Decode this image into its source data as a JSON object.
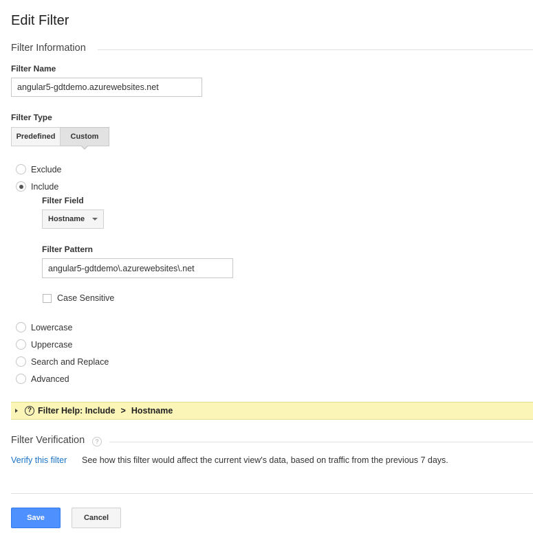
{
  "page": {
    "title": "Edit Filter"
  },
  "info_section": {
    "title": "Filter Information",
    "name_label": "Filter Name",
    "name_value": "angular5-gdtdemo.azurewebsites.net",
    "type_label": "Filter Type",
    "type_tabs": [
      "Predefined",
      "Custom"
    ],
    "selected_type": "Custom"
  },
  "options": {
    "exclude_label": "Exclude",
    "include_label": "Include",
    "selected": "Include",
    "include_panel": {
      "field_label": "Filter Field",
      "field_value": "Hostname",
      "pattern_label": "Filter Pattern",
      "pattern_value": "angular5-gdtdemo\\.azurewebsites\\.net",
      "case_sensitive_label": "Case Sensitive",
      "case_sensitive_checked": false
    },
    "lowercase_label": "Lowercase",
    "uppercase_label": "Uppercase",
    "search_replace_label": "Search and Replace",
    "advanced_label": "Advanced"
  },
  "help_bar": {
    "prefix": "Filter Help: ",
    "option": "Include",
    "separator": ">",
    "field": "Hostname",
    "icon_glyph": "?"
  },
  "verification": {
    "title": "Filter Verification",
    "help_glyph": "?",
    "link_label": "Verify this filter",
    "description": "See how this filter would affect the current view's data, based on traffic from the previous 7 days."
  },
  "actions": {
    "save_label": "Save",
    "cancel_label": "Cancel"
  },
  "colors": {
    "accent": "#4d90fe",
    "link": "#1a73c8",
    "help_bg": "#fbf5b8"
  }
}
